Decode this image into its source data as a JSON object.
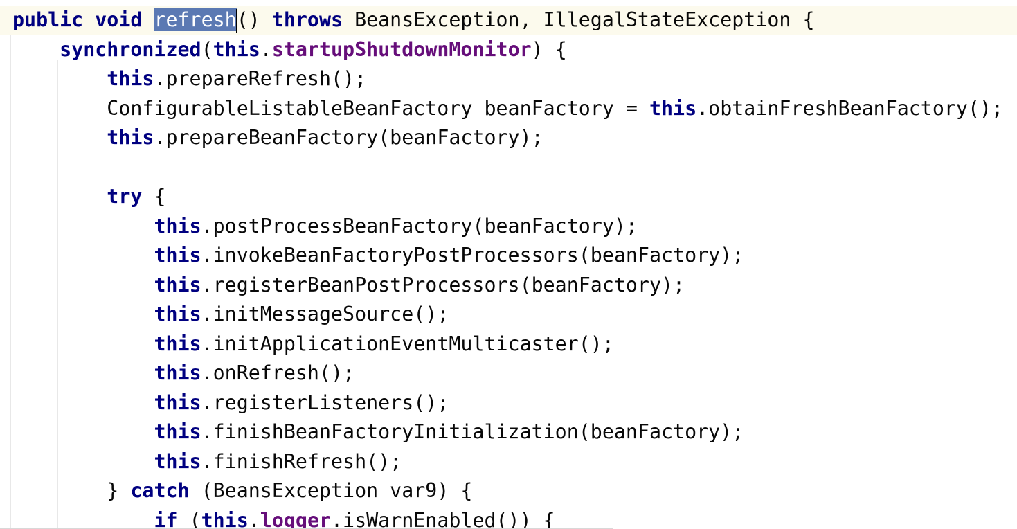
{
  "editor": {
    "lines": [
      {
        "indent": "",
        "tokens": [
          [
            "kw",
            "public void "
          ],
          [
            "sel",
            "refresh"
          ],
          [
            "caret",
            ""
          ],
          [
            "txt",
            "() "
          ],
          [
            "kw",
            "throws"
          ],
          [
            "txt",
            " BeansException, IllegalStateException {"
          ]
        ]
      },
      {
        "indent": "    ",
        "tokens": [
          [
            "kw",
            "synchronized"
          ],
          [
            "txt",
            "("
          ],
          [
            "kw",
            "this"
          ],
          [
            "txt",
            "."
          ],
          [
            "fld",
            "startupShutdownMonitor"
          ],
          [
            "txt",
            ") {"
          ]
        ]
      },
      {
        "indent": "        ",
        "tokens": [
          [
            "kw",
            "this"
          ],
          [
            "txt",
            ".prepareRefresh();"
          ]
        ]
      },
      {
        "indent": "        ",
        "tokens": [
          [
            "txt",
            "ConfigurableListableBeanFactory beanFactory = "
          ],
          [
            "kw",
            "this"
          ],
          [
            "txt",
            ".obtainFreshBeanFactory();"
          ]
        ]
      },
      {
        "indent": "        ",
        "tokens": [
          [
            "kw",
            "this"
          ],
          [
            "txt",
            ".prepareBeanFactory(beanFactory);"
          ]
        ]
      },
      {
        "indent": "",
        "tokens": []
      },
      {
        "indent": "        ",
        "tokens": [
          [
            "kw",
            "try"
          ],
          [
            "txt",
            " {"
          ]
        ]
      },
      {
        "indent": "            ",
        "tokens": [
          [
            "kw",
            "this"
          ],
          [
            "txt",
            ".postProcessBeanFactory(beanFactory);"
          ]
        ]
      },
      {
        "indent": "            ",
        "tokens": [
          [
            "kw",
            "this"
          ],
          [
            "txt",
            ".invokeBeanFactoryPostProcessors(beanFactory);"
          ]
        ]
      },
      {
        "indent": "            ",
        "tokens": [
          [
            "kw",
            "this"
          ],
          [
            "txt",
            ".registerBeanPostProcessors(beanFactory);"
          ]
        ]
      },
      {
        "indent": "            ",
        "tokens": [
          [
            "kw",
            "this"
          ],
          [
            "txt",
            ".initMessageSource();"
          ]
        ]
      },
      {
        "indent": "            ",
        "tokens": [
          [
            "kw",
            "this"
          ],
          [
            "txt",
            ".initApplicationEventMulticaster();"
          ]
        ]
      },
      {
        "indent": "            ",
        "tokens": [
          [
            "kw",
            "this"
          ],
          [
            "txt",
            ".onRefresh();"
          ]
        ]
      },
      {
        "indent": "            ",
        "tokens": [
          [
            "kw",
            "this"
          ],
          [
            "txt",
            ".registerListeners();"
          ]
        ]
      },
      {
        "indent": "            ",
        "tokens": [
          [
            "kw",
            "this"
          ],
          [
            "txt",
            ".finishBeanFactoryInitialization(beanFactory);"
          ]
        ]
      },
      {
        "indent": "            ",
        "tokens": [
          [
            "kw",
            "this"
          ],
          [
            "txt",
            ".finishRefresh();"
          ]
        ]
      },
      {
        "indent": "        ",
        "tokens": [
          [
            "txt",
            "} "
          ],
          [
            "kw",
            "catch"
          ],
          [
            "txt",
            " (BeansException var9) {"
          ]
        ]
      },
      {
        "indent": "            ",
        "tokens": [
          [
            "kw",
            "if"
          ],
          [
            "txt",
            " ("
          ],
          [
            "kw",
            "this"
          ],
          [
            "txt",
            "."
          ],
          [
            "fld",
            "logger"
          ],
          [
            "txt",
            ".isWarnEnabled()) {"
          ]
        ]
      }
    ]
  }
}
